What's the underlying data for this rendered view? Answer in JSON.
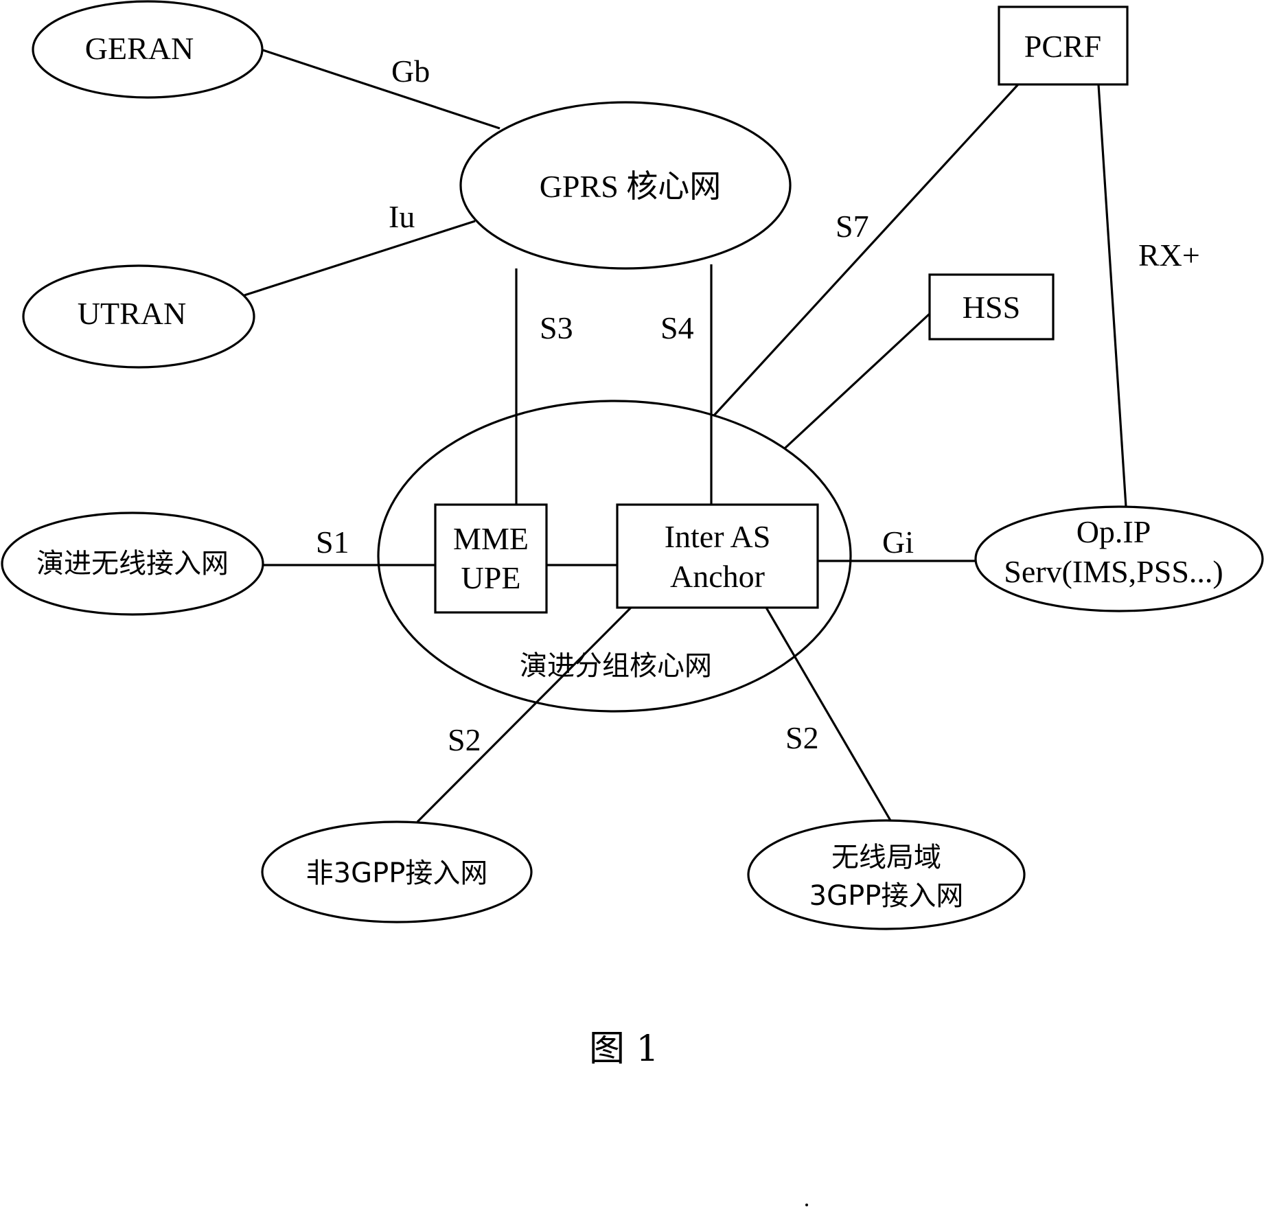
{
  "figure": {
    "caption": "图 1",
    "nodes": {
      "geran": {
        "label": "GERAN",
        "shape": "ellipse"
      },
      "utran": {
        "label": "UTRAN",
        "shape": "ellipse"
      },
      "gprs_core": {
        "label": "GPRS 核心网",
        "shape": "ellipse"
      },
      "pcrf": {
        "label": "PCRF",
        "shape": "box"
      },
      "hss": {
        "label": "HSS",
        "shape": "box"
      },
      "eutran": {
        "label": "演进无线接入网",
        "shape": "ellipse"
      },
      "epc": {
        "label": "演进分组核心网",
        "shape": "ellipse"
      },
      "mme_upe": {
        "lines": [
          "MME",
          "UPE"
        ],
        "shape": "box"
      },
      "inter_as_anchor": {
        "lines": [
          "Inter AS",
          "Anchor"
        ],
        "shape": "box"
      },
      "op_ip_serv": {
        "lines": [
          "Op.IP",
          "Serv(IMS,PSS...)"
        ],
        "shape": "ellipse"
      },
      "non_3gpp": {
        "label": "非3GPP接入网",
        "shape": "ellipse"
      },
      "wlan_3gpp": {
        "lines": [
          "无线局域",
          "3GPP接入网"
        ],
        "shape": "ellipse"
      }
    },
    "interfaces": {
      "gb": {
        "label": "Gb",
        "from": "GERAN",
        "to": "GPRS 核心网"
      },
      "iu": {
        "label": "Iu",
        "from": "UTRAN",
        "to": "GPRS 核心网"
      },
      "s3": {
        "label": "S3",
        "from": "GPRS 核心网",
        "to": "MME UPE"
      },
      "s4": {
        "label": "S4",
        "from": "GPRS 核心网",
        "to": "Inter AS Anchor"
      },
      "s7": {
        "label": "S7",
        "from": "PCRF",
        "to": "Inter AS Anchor"
      },
      "hss_link": {
        "label": "",
        "from": "HSS",
        "to": "演进分组核心网"
      },
      "rx_plus": {
        "label": "RX+",
        "from": "PCRF",
        "to": "Op.IP Serv"
      },
      "s1": {
        "label": "S1",
        "from": "演进无线接入网",
        "to": "MME UPE"
      },
      "mme_anchor": {
        "label": "",
        "from": "MME UPE",
        "to": "Inter AS Anchor"
      },
      "gi": {
        "label": "Gi",
        "from": "Inter AS Anchor",
        "to": "Op.IP Serv"
      },
      "s2_left": {
        "label": "S2",
        "from": "Inter AS Anchor",
        "to": "非3GPP接入网"
      },
      "s2_right": {
        "label": "S2",
        "from": "Inter AS Anchor",
        "to": "无线局域 3GPP接入网"
      }
    }
  }
}
